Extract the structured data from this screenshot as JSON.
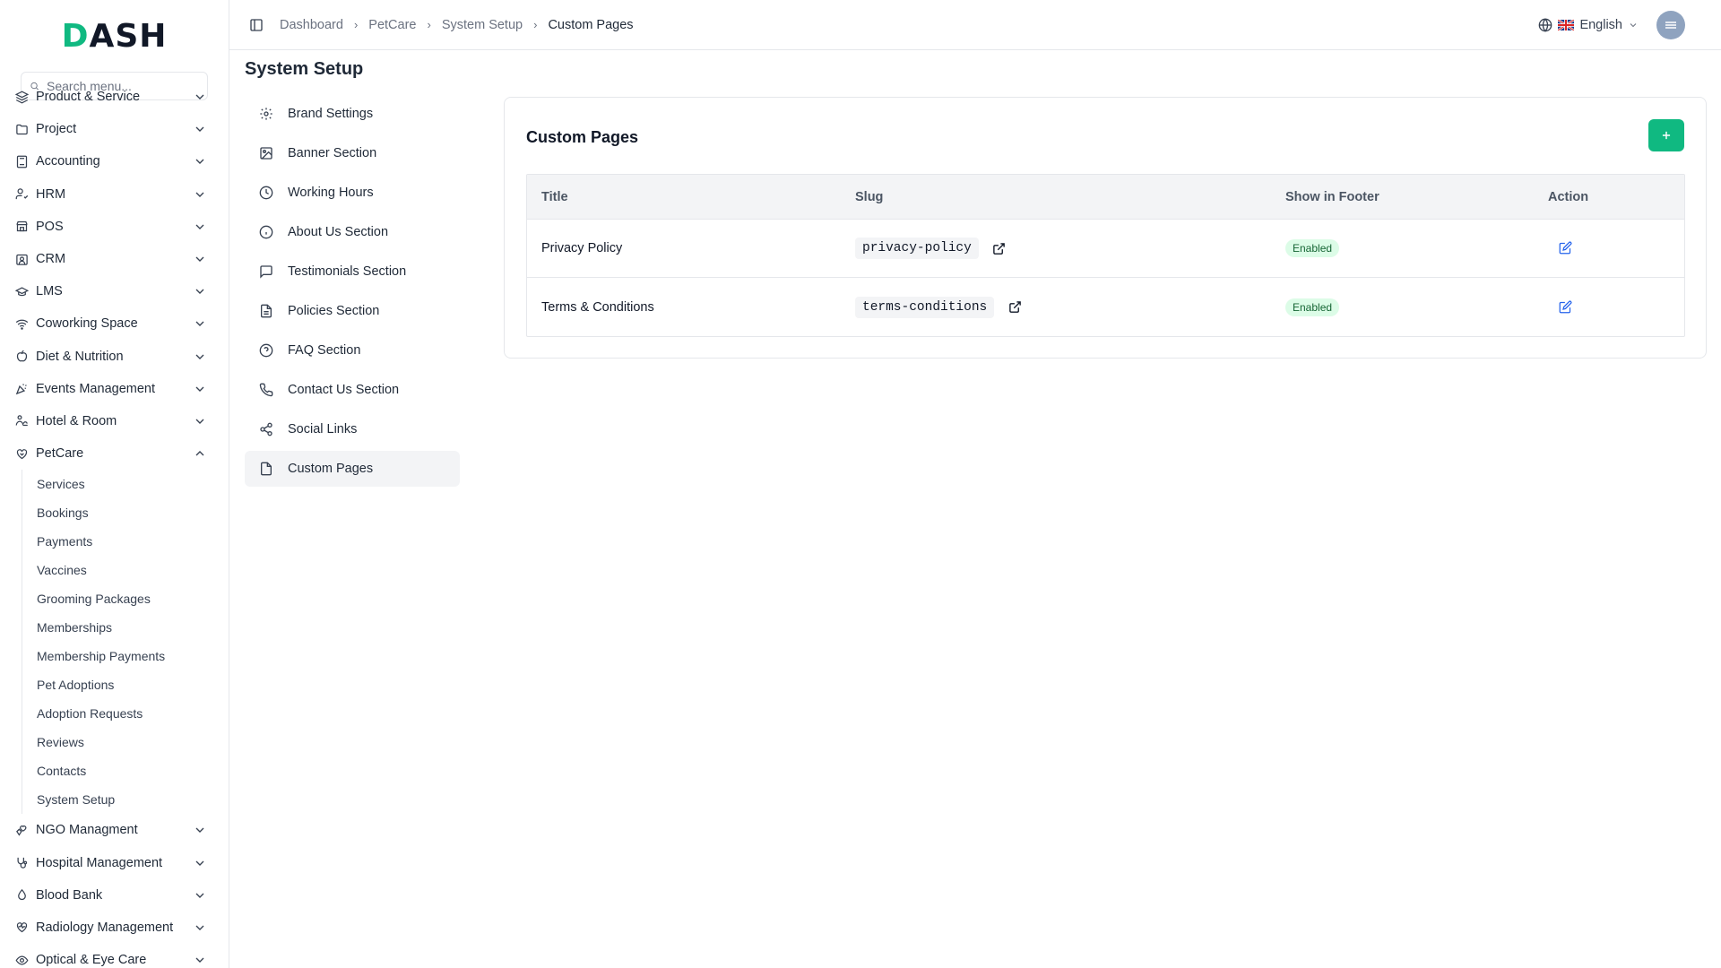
{
  "app": {
    "logo": "DASH"
  },
  "sidebar": {
    "search_placeholder": "Search menu...",
    "items": [
      {
        "label": "Product & Service",
        "icon": "layers-icon"
      },
      {
        "label": "Project",
        "icon": "folder-icon"
      },
      {
        "label": "Accounting",
        "icon": "calculator-icon"
      },
      {
        "label": "HRM",
        "icon": "users-icon"
      },
      {
        "label": "POS",
        "icon": "store-icon"
      },
      {
        "label": "CRM",
        "icon": "contact-icon"
      },
      {
        "label": "LMS",
        "icon": "graduation-cap-icon"
      },
      {
        "label": "Coworking Space",
        "icon": "wifi-icon"
      },
      {
        "label": "Diet & Nutrition",
        "icon": "apple-icon"
      },
      {
        "label": "Events Management",
        "icon": "party-icon"
      },
      {
        "label": "Hotel & Room",
        "icon": "concierge-icon"
      },
      {
        "label": "PetCare",
        "icon": "paw-heart-icon",
        "expanded": true
      }
    ],
    "petcare_sub": [
      "Services",
      "Bookings",
      "Payments",
      "Vaccines",
      "Grooming Packages",
      "Memberships",
      "Membership Payments",
      "Pet Adoptions",
      "Adoption Requests",
      "Reviews",
      "Contacts",
      "System Setup"
    ],
    "items_after": [
      {
        "label": "NGO Managment",
        "icon": "hand-heart-icon"
      },
      {
        "label": "Hospital Management",
        "icon": "stethoscope-icon"
      },
      {
        "label": "Blood Bank",
        "icon": "droplet-icon"
      },
      {
        "label": "Radiology Management",
        "icon": "heart-pulse-icon"
      },
      {
        "label": "Optical & Eye Care",
        "icon": "eye-icon"
      }
    ]
  },
  "topbar": {
    "breadcrumbs": [
      "Dashboard",
      "PetCare",
      "System Setup",
      "Custom Pages"
    ],
    "language": "English"
  },
  "page": {
    "title": "System Setup"
  },
  "setup_nav": [
    {
      "label": "Brand Settings",
      "icon": "gear-icon"
    },
    {
      "label": "Banner Section",
      "icon": "image-icon"
    },
    {
      "label": "Working Hours",
      "icon": "clock-icon"
    },
    {
      "label": "About Us Section",
      "icon": "info-icon"
    },
    {
      "label": "Testimonials Section",
      "icon": "message-square-icon"
    },
    {
      "label": "Policies Section",
      "icon": "file-text-icon"
    },
    {
      "label": "FAQ Section",
      "icon": "help-circle-icon"
    },
    {
      "label": "Contact Us Section",
      "icon": "phone-icon"
    },
    {
      "label": "Social Links",
      "icon": "share-icon"
    },
    {
      "label": "Custom Pages",
      "icon": "file-icon",
      "active": true
    }
  ],
  "custom_pages": {
    "title": "Custom Pages",
    "columns": [
      "Title",
      "Slug",
      "Show in Footer",
      "Action"
    ],
    "rows": [
      {
        "title": "Privacy Policy",
        "slug": "privacy-policy",
        "footer": "Enabled"
      },
      {
        "title": "Terms & Conditions",
        "slug": "terms-conditions",
        "footer": "Enabled"
      }
    ]
  },
  "colors": {
    "accent": "#10b981",
    "link_icon": "#2563eb",
    "badge_bg": "#dcfce7",
    "badge_text": "#166534"
  }
}
